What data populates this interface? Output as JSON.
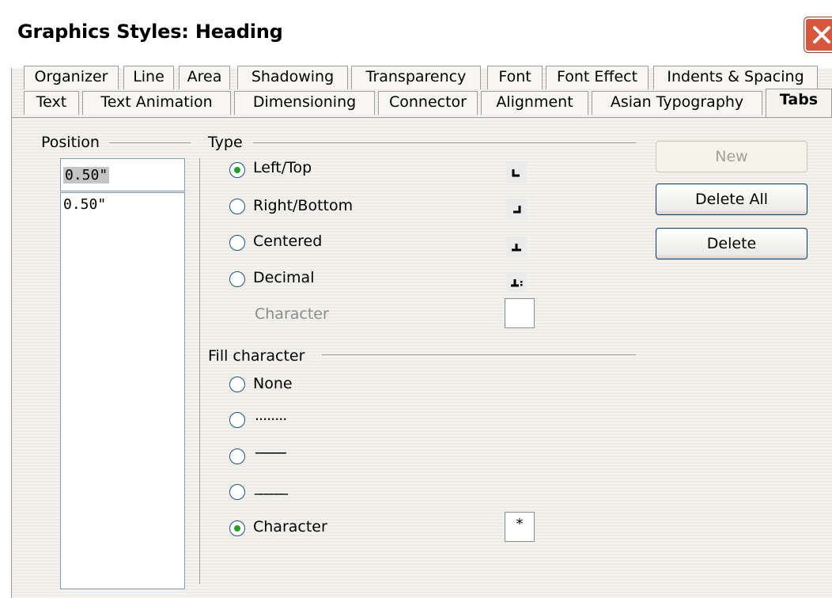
{
  "window": {
    "title": "Graphics Styles: Heading",
    "close_icon": "close-x-icon"
  },
  "tabs": {
    "row1": [
      "Organizer",
      "Line",
      "Area",
      "Shadowing",
      "Transparency",
      "Font",
      "Font Effect",
      "Indents & Spacing"
    ],
    "row2": [
      "Text",
      "Text Animation",
      "Dimensioning",
      "Connector",
      "Alignment",
      "Asian Typography",
      "Tabs"
    ],
    "active": "Tabs"
  },
  "position": {
    "label": "Position",
    "input_value": "0.50\"",
    "list_items": [
      "0.50\""
    ]
  },
  "type": {
    "label": "Type",
    "options": [
      {
        "label": "Left/Top",
        "checked": true,
        "icon": "tab-left-icon"
      },
      {
        "label": "Right/Bottom",
        "checked": false,
        "icon": "tab-right-icon"
      },
      {
        "label": "Centered",
        "checked": false,
        "icon": "tab-center-icon"
      },
      {
        "label": "Decimal",
        "checked": false,
        "icon": "tab-decimal-icon"
      }
    ],
    "character_label": "Character",
    "character_value": ""
  },
  "fill": {
    "label": "Fill character",
    "options": [
      {
        "label": "None",
        "checked": false
      },
      {
        "label": "........",
        "checked": false
      },
      {
        "label": "--------",
        "checked": false
      },
      {
        "label": "______",
        "checked": false
      },
      {
        "label": "Character",
        "checked": true
      }
    ],
    "character_value": "*"
  },
  "buttons": {
    "new": "New",
    "delete_all": "Delete All",
    "delete": "Delete"
  },
  "colors": {
    "radio_dot": "#21a121",
    "close_button": "#d7573d",
    "focus_border": "#7f9db9"
  }
}
